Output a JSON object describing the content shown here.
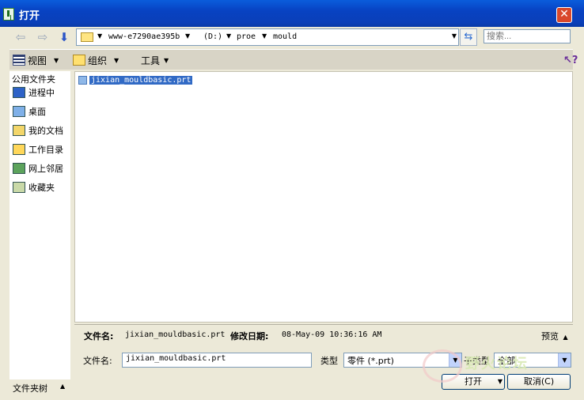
{
  "window": {
    "title": "打开"
  },
  "nav": {
    "back_icon": "arrow-left-icon",
    "forward_icon": "arrow-right-icon",
    "down_icon": "arrow-down-icon",
    "path": [
      "www-e7290ae395b",
      "(D:)",
      "proe",
      "mould"
    ],
    "search_placeholder": "搜索..."
  },
  "toolbar": {
    "view_label": "视图",
    "organize_label": "组织",
    "tools_label": "工具"
  },
  "sidebar": {
    "title": "公用文件夹",
    "items": [
      {
        "label": "进程中",
        "icon": "process-icon"
      },
      {
        "label": "桌面",
        "icon": "desktop-icon"
      },
      {
        "label": "我的文档",
        "icon": "documents-icon"
      },
      {
        "label": "工作目录",
        "icon": "folder-icon"
      },
      {
        "label": "网上邻居",
        "icon": "network-icon"
      },
      {
        "label": "收藏夹",
        "icon": "favorites-icon"
      }
    ],
    "folder_tree_label": "文件夹树"
  },
  "files": [
    {
      "name": "jixian_mouldbasic.prt"
    }
  ],
  "info": {
    "name_label": "文件名:",
    "name_value": "jixian_mouldbasic.prt",
    "date_label": "修改日期:",
    "date_value": "08-May-09 10:36:16 AM",
    "preview_label": "预览"
  },
  "form": {
    "filename_label": "文件名:",
    "filename_value": "jixian_mouldbasic.prt",
    "type_label": "类型",
    "type_value": "零件 (*.prt)",
    "subtype_label": "子类型",
    "subtype_value": "全部",
    "open_label": "打开",
    "cancel_label": "取消(C)"
  },
  "watermark": {
    "text": "野火论坛"
  }
}
